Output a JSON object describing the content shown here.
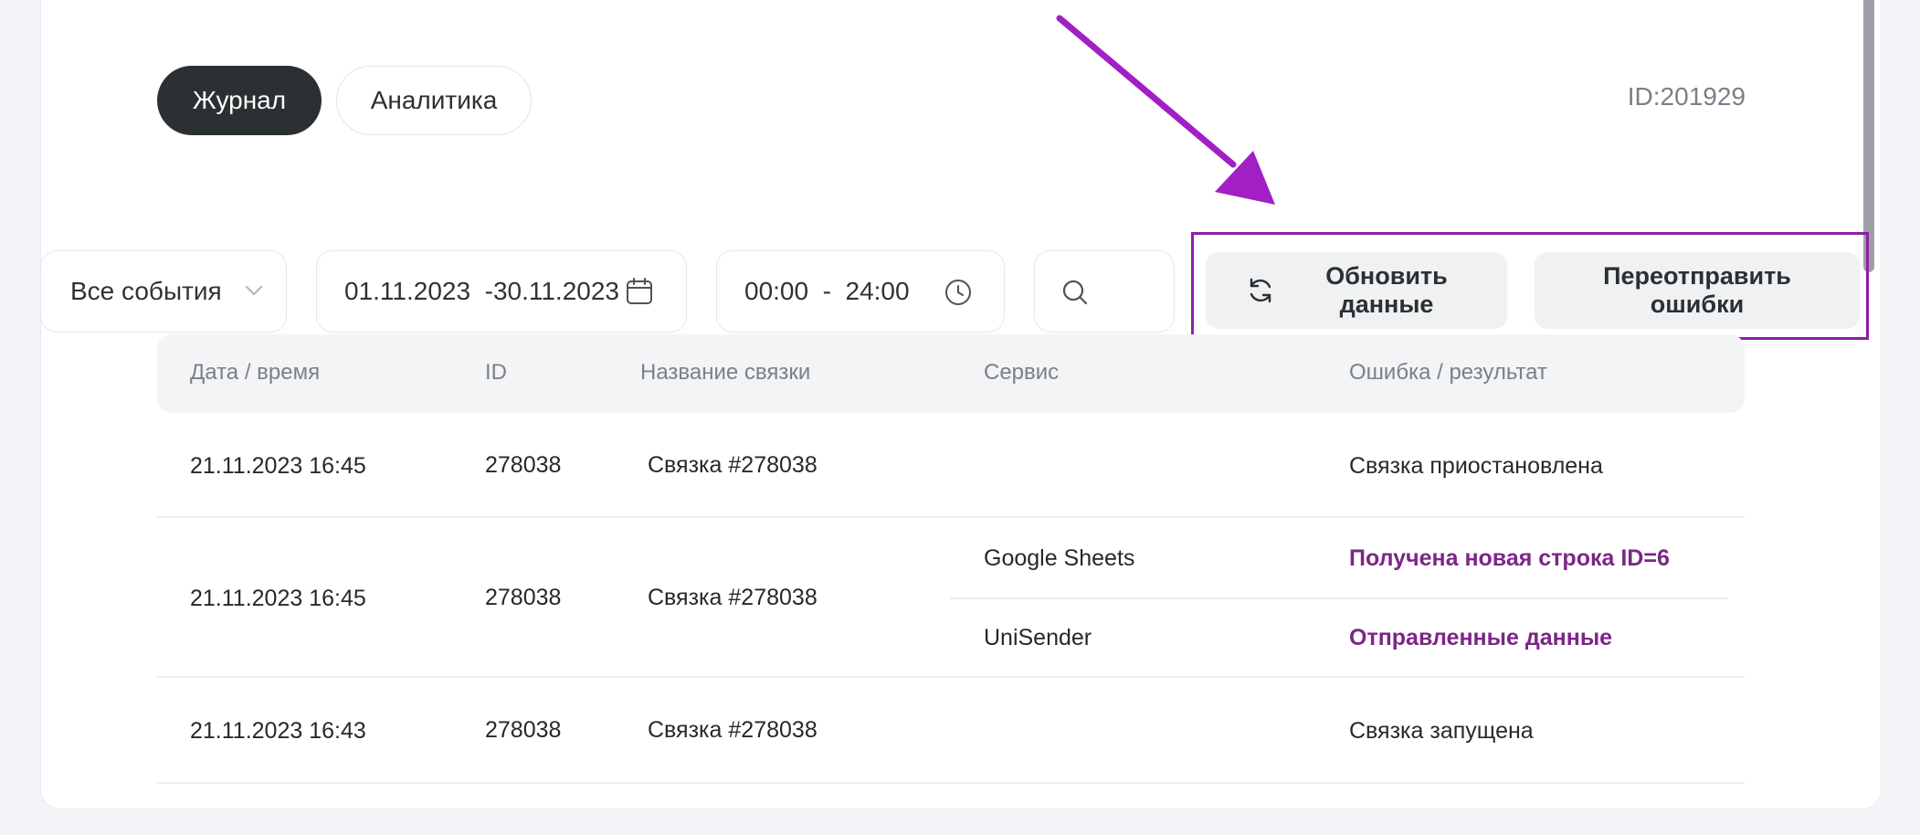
{
  "tabs": {
    "journal": "Журнал",
    "analytics": "Аналитика"
  },
  "page_id": "ID:201929",
  "filters": {
    "events": "Все события",
    "date_range": "01.11.2023  -30.11.2023",
    "time_range": "00:00  -  24:00"
  },
  "buttons": {
    "refresh": "Обновить данные",
    "resend": "Переотправить ошибки"
  },
  "table": {
    "headers": {
      "datetime": "Дата / время",
      "id": "ID",
      "name": "Название связки",
      "service": "Сервис",
      "result": "Ошибка / результат"
    },
    "rows": [
      {
        "datetime": "21.11.2023 16:45",
        "id": "278038",
        "name": "Связка #278038",
        "result": "Связка приостановлена"
      },
      {
        "datetime": "21.11.2023 16:45",
        "id": "278038",
        "name": "Связка #278038",
        "services": [
          {
            "service": "Google Sheets",
            "result": "Получена новая строка ID=6"
          },
          {
            "service": "UniSender",
            "result": "Отправленные данные"
          }
        ]
      },
      {
        "datetime": "21.11.2023 16:43",
        "id": "278038",
        "name": "Связка #278038",
        "result": "Связка запущена"
      }
    ]
  },
  "colors": {
    "accent": "#7b2686",
    "highlight": "#8c1fa8",
    "dark": "#2b3032"
  },
  "icons": [
    "chevron-down-icon",
    "calendar-icon",
    "clock-icon",
    "search-icon",
    "refresh-icon",
    "arrow-annotation"
  ]
}
